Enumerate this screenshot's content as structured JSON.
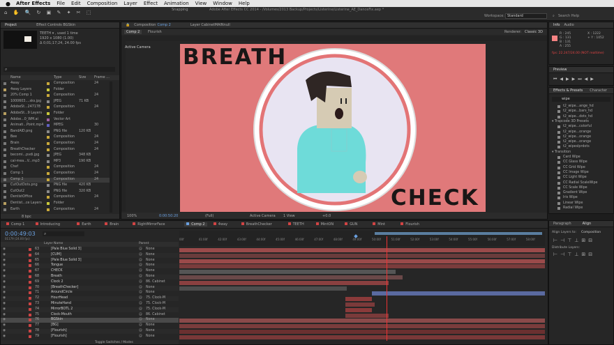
{
  "menubar": {
    "apple": "",
    "app": "After Effects",
    "items": [
      "File",
      "Edit",
      "Composition",
      "Layer",
      "Effect",
      "Animation",
      "View",
      "Window",
      "Help"
    ]
  },
  "toolbar": {
    "snapping": "Snapping",
    "title": "Adobe After Effects CC 2014 - /Volumes/2013 Backup/Projects/Listerine/Listerine_AE_DanceFix.aep *",
    "workspace_label": "Workspace:",
    "workspace_value": "Standard",
    "search_placeholder": "Search Help"
  },
  "project": {
    "tab": "Project",
    "tab2": "Effect Controls BGSkin",
    "thumb_name": "TEETH ▾ , used 1 time",
    "thumb_size": "1920 x 1080 (1.00)",
    "thumb_dur": "Δ 0;01;17;24, 24.00 fps",
    "cols": {
      "name": "Name",
      "type": "Type",
      "size": "Size",
      "fps": "Frame ..."
    },
    "items": [
      {
        "name": "4way",
        "type": "Composition",
        "size": "",
        "fps": "24",
        "color": "#c8a83a"
      },
      {
        "name": "4way Layers",
        "type": "Folder",
        "size": "",
        "fps": "",
        "color": "#c8c83a"
      },
      {
        "name": "20% Comp 1",
        "type": "Composition",
        "size": "",
        "fps": "24",
        "color": "#c8a83a"
      },
      {
        "name": "1000603....sks.jpg",
        "type": "JPEG",
        "size": "71 KB",
        "fps": "",
        "color": "#8a8a8a"
      },
      {
        "name": "AdobeSt...247178",
        "type": "Composition",
        "size": "",
        "fps": "24",
        "color": "#c8a83a"
      },
      {
        "name": "AdobeSt...9 Layers",
        "type": "Folder",
        "size": "",
        "fps": "",
        "color": "#c8c83a"
      },
      {
        "name": "Adobe...0_WM.ai",
        "type": "Vector Art",
        "size": "",
        "fps": "",
        "color": "#a060a0"
      },
      {
        "name": "Animati...Point.mp4",
        "type": "MPEG",
        "size": "",
        "fps": "30",
        "color": "#6060c0"
      },
      {
        "name": "BandAID.png",
        "type": "PNG file",
        "size": "120 KB",
        "fps": "",
        "color": "#8a8a8a"
      },
      {
        "name": "Bee",
        "type": "Composition",
        "size": "",
        "fps": "24",
        "color": "#c8a83a"
      },
      {
        "name": "Brain",
        "type": "Composition",
        "size": "",
        "fps": "24",
        "color": "#c8a83a"
      },
      {
        "name": "BreathChecker",
        "type": "Composition",
        "size": "",
        "fps": "24",
        "color": "#c8a83a"
      },
      {
        "name": "becomi...pvdi.jpg",
        "type": "JPEG",
        "size": "348 KB",
        "fps": "",
        "color": "#8a8a8a"
      },
      {
        "name": "cal-mea...V...mp3",
        "type": "MP3",
        "size": "190 KB",
        "fps": "",
        "color": "#8a8a8a"
      },
      {
        "name": "Chef",
        "type": "Composition",
        "size": "",
        "fps": "24",
        "color": "#c8a83a"
      },
      {
        "name": "Comp 1",
        "type": "Composition",
        "size": "",
        "fps": "24",
        "color": "#c8a83a"
      },
      {
        "name": "Comp 2",
        "type": "Composition",
        "size": "",
        "fps": "24",
        "color": "#c8a83a"
      },
      {
        "name": "CutOutDots.png",
        "type": "PNG file",
        "size": "420 KB",
        "fps": "",
        "color": "#8a8a8a"
      },
      {
        "name": "CutOut2",
        "type": "PNG file",
        "size": "320 KB",
        "fps": "",
        "color": "#8a8a8a"
      },
      {
        "name": "DentistOffice",
        "type": "Composition",
        "size": "",
        "fps": "24",
        "color": "#c8a83a"
      },
      {
        "name": "Dentist...ce Layers",
        "type": "Folder",
        "size": "",
        "fps": "",
        "color": "#c8c83a"
      },
      {
        "name": "Earth",
        "type": "Composition",
        "size": "",
        "fps": "24",
        "color": "#c8a83a"
      }
    ],
    "footer": "8 bpc"
  },
  "composition": {
    "tab_label": "Composition",
    "tab_comp": "Comp 2",
    "tab_layer": "Layer CabinetMAINnull",
    "subtab1": "Comp 2",
    "subtab2": "Flourish",
    "renderer_label": "Renderer:",
    "renderer": "Classic 3D",
    "camera_label": "Active Camera",
    "breath": "BREATH",
    "check": "CHECK",
    "footer": {
      "zoom": "100%",
      "timecode": "0:00:50:20",
      "res": "(Full)",
      "camera": "Active Camera",
      "views": "1 View",
      "offset": "+0.0"
    }
  },
  "info": {
    "tab": "Info",
    "tab2": "Audio",
    "r": "R : 245",
    "g": "G : 131",
    "b": "B : 131",
    "a": "A : 255",
    "x": "X : 1222",
    "y": "+ Y : 1052",
    "fps": "fps: 22.247/24.00 (NOT realtime)",
    "swatch": "#f58383"
  },
  "preview": {
    "tab": "Preview"
  },
  "effects": {
    "tab": "Effects & Presets",
    "tab2": "Character",
    "search": "wipe",
    "items": [
      "t2_wipe...ange_hd",
      "t2_wipe...bars_hd",
      "t2_wipe...dots_hd",
      "▾ Trapcode 3D Presets",
      "t2_wipe...colorful",
      "t2_wipe...orange",
      "t2_wipe...orange",
      "t2_wipe...orange",
      "t2_wipeslprdots",
      "▾ Transition",
      "Card Wipe",
      "CC Glass Wipe",
      "CC Grid Wipe",
      "CC Image Wipe",
      "CC Light Wipe",
      "CC Radial ScaleWipe",
      "CC Scale Wipe",
      "Gradient Wipe",
      "Iris Wipe",
      "Linear Wipe",
      "Radial Wipe"
    ]
  },
  "timeline": {
    "tabs": [
      "Comp 1",
      "Introducing",
      "Earth",
      "Brain",
      "RightMirrorFace",
      "Comp 2",
      "4way",
      "BreathChecker",
      "TEETH",
      "MintON",
      "GUN",
      "Mint",
      "Flourish"
    ],
    "timecode": "0:00:49:03",
    "timecode_sub": "01179 (24.00 fps)",
    "col_layer": "Layer Name",
    "col_parent": "Parent",
    "layers": [
      {
        "num": "63",
        "name": "[Pale Blue Solid 3]",
        "color": "#c44",
        "parent": "None"
      },
      {
        "num": "64",
        "name": "[CUM]",
        "color": "#c44",
        "parent": "None"
      },
      {
        "num": "65",
        "name": "[Pale Blue Solid 3]",
        "color": "#c44",
        "parent": "None"
      },
      {
        "num": "66",
        "name": "Tongue",
        "color": "#c44",
        "parent": "None"
      },
      {
        "num": "67",
        "name": "CHECK",
        "color": "#c44",
        "parent": "None"
      },
      {
        "num": "68",
        "name": "Breath",
        "color": "#c44",
        "parent": "None"
      },
      {
        "num": "69",
        "name": "Clock 2",
        "color": "#c44",
        "parent": "86. Cabinet"
      },
      {
        "num": "70",
        "name": "[BreathChecker]",
        "color": "#c44",
        "parent": "None"
      },
      {
        "num": "71",
        "name": "AroundCircle",
        "color": "#c44",
        "parent": "None"
      },
      {
        "num": "72",
        "name": "HourHead",
        "color": "#c44",
        "parent": "75. Clock-M"
      },
      {
        "num": "73",
        "name": "MinuteHand",
        "color": "#c44",
        "parent": "75. Clock-M"
      },
      {
        "num": "74",
        "name": "MirrorBOTL 2",
        "color": "#c44",
        "parent": "75. Clock-M"
      },
      {
        "num": "75",
        "name": "Clock-Mouth",
        "color": "#c44",
        "parent": "86. Cabinet"
      },
      {
        "num": "76",
        "name": "BGSkin",
        "color": "#c44",
        "parent": "None"
      },
      {
        "num": "77",
        "name": "[BG]",
        "color": "#c44",
        "parent": "None"
      },
      {
        "num": "78",
        "name": "[Flourish]",
        "color": "#c44",
        "parent": "None"
      },
      {
        "num": "79",
        "name": "[Flourish]",
        "color": "#c44",
        "parent": "None"
      }
    ],
    "footer": "Toggle Switches / Modes",
    "ruler": [
      "00f",
      "41:00f",
      "42:00f",
      "43:00f",
      "44:00f",
      "45:00f",
      "46:00f",
      "47:00f",
      "48:00f",
      "49:00f",
      "50:00f",
      "51:00f",
      "52:00f",
      "53:00f",
      "54:00f",
      "55:00f",
      "56:00f",
      "57:00f",
      "58:00f"
    ]
  },
  "paragraph": {
    "tab": "Paragraph",
    "tab2": "Align",
    "align_label": "Align Layers to:",
    "align_value": "Composition",
    "distribute": "Distribute Layers:"
  }
}
